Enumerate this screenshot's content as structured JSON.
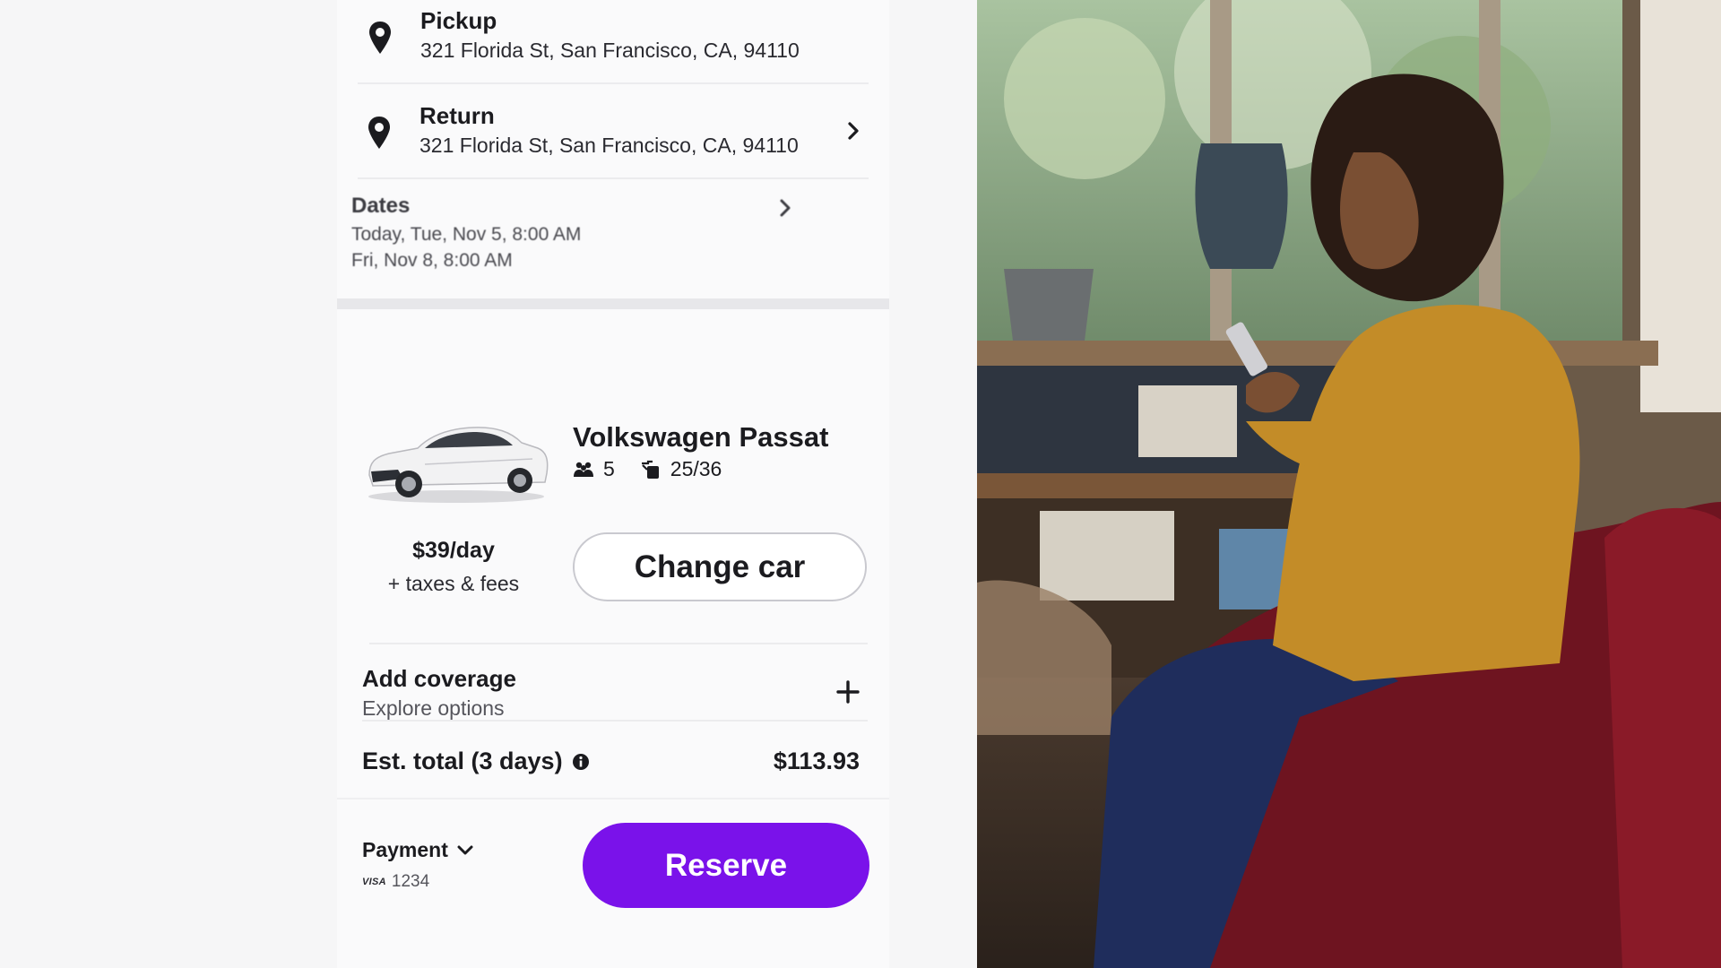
{
  "pickup": {
    "title": "Pickup",
    "address": "321 Florida St, San Francisco, CA, 94110"
  },
  "return": {
    "title": "Return",
    "address": "321 Florida St, San Francisco, CA, 94110"
  },
  "dates": {
    "title": "Dates",
    "start": "Today, Tue, Nov 5, 8:00 AM",
    "end": "Fri, Nov 8, 8:00 AM"
  },
  "car": {
    "name": "Volkswagen Passat",
    "seats": "5",
    "mpg": "25/36"
  },
  "price": {
    "rate": "$39/day",
    "note": "+ taxes & fees"
  },
  "change_car_label": "Change car",
  "coverage": {
    "title": "Add coverage",
    "subtitle": "Explore options"
  },
  "total": {
    "label": "Est. total (3 days)",
    "value": "$113.93"
  },
  "payment": {
    "label": "Payment",
    "card_brand": "VISA",
    "card_last4": "1234"
  },
  "reserve_label": "Reserve",
  "colors": {
    "accent": "#7a12ea",
    "text": "#1b1b1f",
    "muted": "#55555c"
  },
  "icons": [
    "location-pin-icon",
    "chevron-right-icon",
    "people-icon",
    "fuel-icon",
    "plus-icon",
    "info-icon",
    "chevron-down-icon"
  ]
}
